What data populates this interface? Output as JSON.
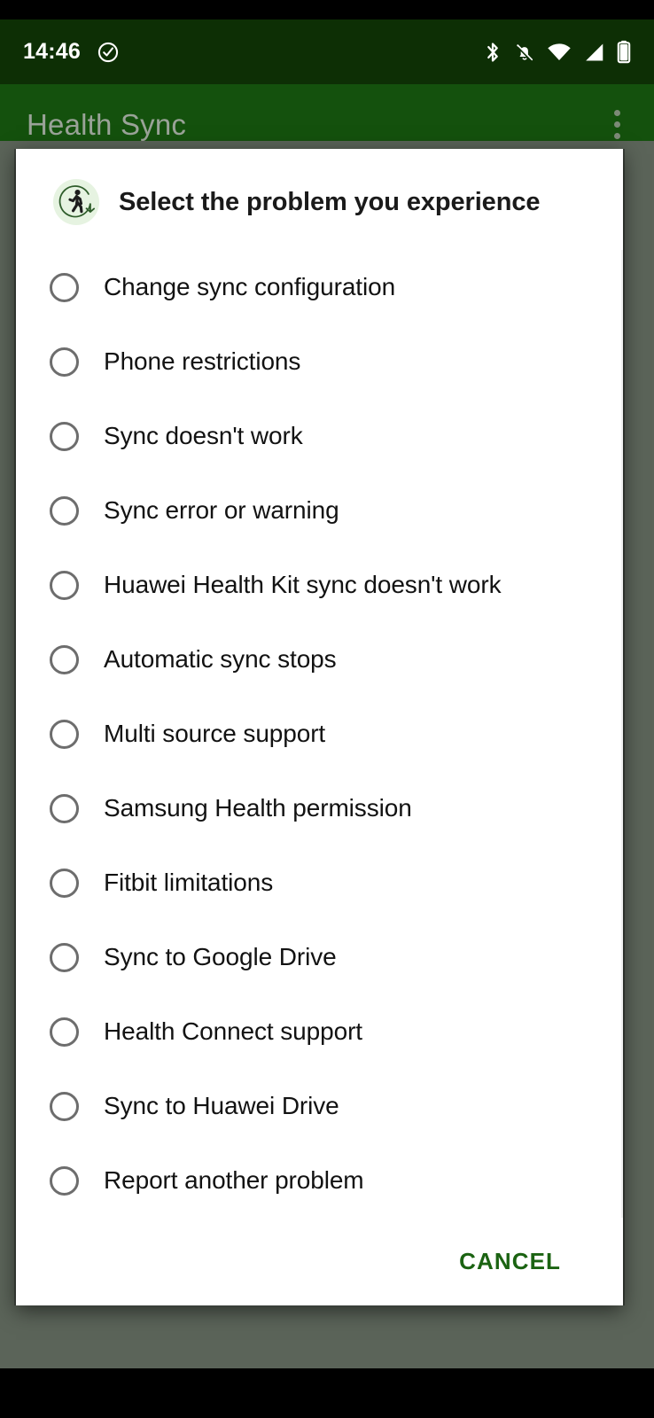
{
  "status_bar": {
    "time": "14:46",
    "icons": [
      {
        "name": "check-circle-icon"
      },
      {
        "name": "bluetooth-icon"
      },
      {
        "name": "notifications-muted-icon"
      },
      {
        "name": "wifi-icon"
      },
      {
        "name": "cellular-signal-icon"
      },
      {
        "name": "battery-icon"
      }
    ],
    "background_color": "#0d2f05",
    "foreground_color": "#ffffff"
  },
  "app_bar": {
    "title": "Health Sync",
    "overflow_icon": "more-vertical-icon",
    "background_color": "#14510d",
    "title_color": "#9aa398"
  },
  "scrim": {
    "color": "#5b6459"
  },
  "dialog": {
    "icon": "walking-sync-icon",
    "title": "Select the problem you experience",
    "options": [
      {
        "label": "Change sync configuration",
        "selected": false
      },
      {
        "label": "Phone restrictions",
        "selected": false
      },
      {
        "label": "Sync doesn't work",
        "selected": false
      },
      {
        "label": "Sync error or warning",
        "selected": false
      },
      {
        "label": "Huawei Health Kit sync doesn't work",
        "selected": false
      },
      {
        "label": "Automatic sync stops",
        "selected": false
      },
      {
        "label": "Multi source support",
        "selected": false
      },
      {
        "label": "Samsung Health permission",
        "selected": false
      },
      {
        "label": "Fitbit limitations",
        "selected": false
      },
      {
        "label": "Sync to Google Drive",
        "selected": false
      },
      {
        "label": "Health Connect support",
        "selected": false
      },
      {
        "label": "Sync to Huawei Drive",
        "selected": false
      },
      {
        "label": "Report another problem",
        "selected": false
      }
    ],
    "cancel_label": "CANCEL",
    "cancel_color": "#1b6312",
    "background_color": "#ffffff"
  }
}
